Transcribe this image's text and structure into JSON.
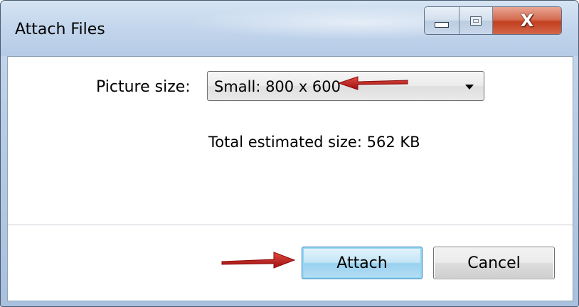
{
  "window": {
    "title": "Attach Files",
    "controls": {
      "minimize": "minimize-icon",
      "maximize": "maximize-icon",
      "close": "close-icon",
      "close_glyph": "X"
    }
  },
  "form": {
    "picture_size_label": "Picture size:",
    "picture_size_selected": "Small: 800 x 600",
    "total_estimated_size": "Total estimated size:  562 KB"
  },
  "buttons": {
    "attach_label": "Attach",
    "cancel_label": "Cancel"
  },
  "annotations": {
    "arrow_color": "#c0181a",
    "arrows": [
      "red-arrow-pointing-at-picture-size",
      "red-arrow-pointing-at-attach-button"
    ]
  },
  "colors": {
    "titlebar": "#c2d5ec",
    "close_button": "#c2401f",
    "attach_button_border": "#3c7fb1"
  }
}
